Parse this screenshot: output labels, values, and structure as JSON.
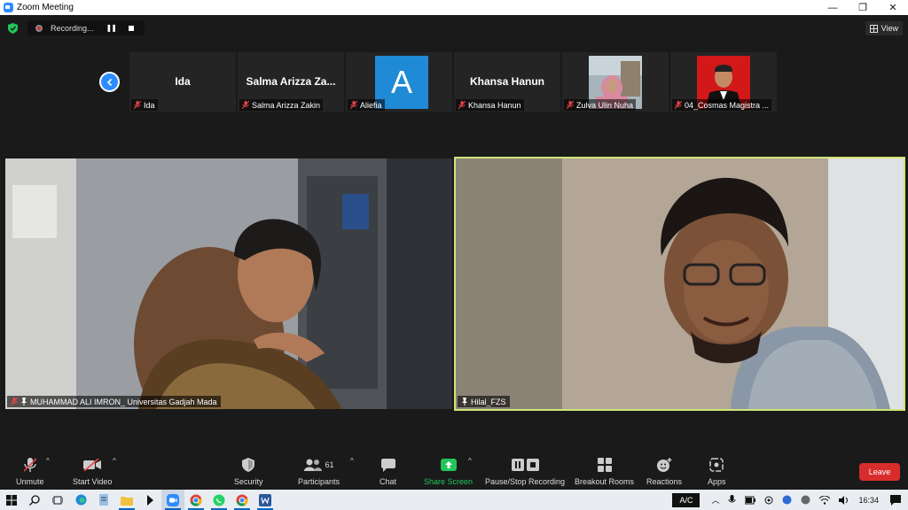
{
  "window": {
    "title": "Zoom Meeting",
    "controls": [
      "—",
      "❐",
      "✕"
    ]
  },
  "recording": {
    "label": "Recording..."
  },
  "view_button": {
    "label": "View"
  },
  "participants_strip": [
    {
      "display": "Ida",
      "label": "Ida",
      "type": "text"
    },
    {
      "display": "Salma  Arizza  Za...",
      "label": "Salma Arizza Zakin",
      "type": "text"
    },
    {
      "display": "A",
      "label": "Aliefia",
      "type": "avatar"
    },
    {
      "display": "Khansa Hanun",
      "label": "Khansa Hanun",
      "type": "text"
    },
    {
      "display": "",
      "label": "Zulva Ulin Nuha",
      "type": "photo"
    },
    {
      "display": "",
      "label": "04_Cosmas Magistra ...",
      "type": "photo"
    }
  ],
  "videos": [
    {
      "name": "MUHAMMAD ALI IMRON_ Universitas Gadjah Mada"
    },
    {
      "name": "Hilal_FZS"
    }
  ],
  "toolbar": {
    "unmute": "Unmute",
    "start_video": "Start Video",
    "security": "Security",
    "participants": "Participants",
    "participants_count": "61",
    "chat": "Chat",
    "share_screen": "Share Screen",
    "pause_stop": "Pause/Stop Recording",
    "breakout": "Breakout Rooms",
    "reactions": "Reactions",
    "apps": "Apps",
    "leave": "Leave"
  },
  "taskbar": {
    "keyboard_label": "A/C",
    "time": "16:34"
  },
  "colors": {
    "accent": "#2d8cff",
    "share_green": "#23c45a",
    "leave_red": "#d92d2d",
    "active_speaker_border": "#cfe676"
  }
}
